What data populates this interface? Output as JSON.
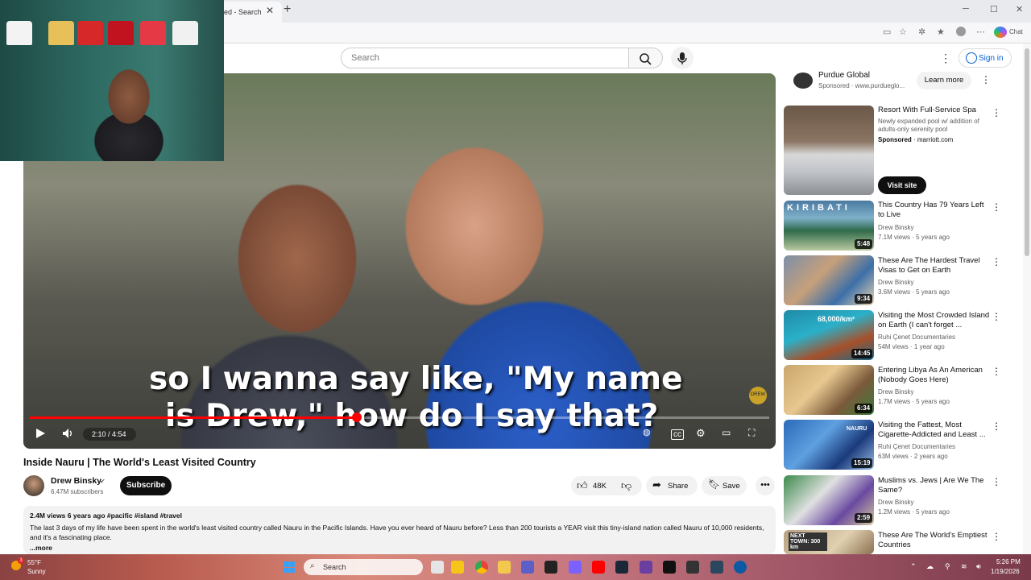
{
  "browser": {
    "tab_title": "ed - Search",
    "tab_close": "✕",
    "new_tab": "+",
    "minimize": "─",
    "maximize": "☐",
    "close": "✕",
    "copilot_label": "Chat"
  },
  "header": {
    "search_placeholder": "Search",
    "menu": "⋮",
    "sign_in": "Sign in"
  },
  "video": {
    "caption_line1": "so I wanna say like, \"My name",
    "caption_line2": "is Drew,\" how do I say that?",
    "time": "2:10 / 4:54",
    "progress_fraction": 0.442,
    "watermark": "DREW"
  },
  "watch": {
    "title": "Inside Nauru | The World's Least Visited Country",
    "channel": "Drew Binsky",
    "subscribers": "6.47M subscribers",
    "subscribe": "Subscribe",
    "likes": "48K",
    "share": "Share",
    "save": "Save",
    "more": "•••",
    "description_stats": "2.4M views  6 years ago  #pacific #island #travel",
    "description": "The last 3 days of my life have been spent in the world's least visited country called Nauru in the Pacific Islands.   Have you ever heard of Nauru before? Less than 200 tourists a YEAR visit this tiny-island nation called Nauru of 10,000 residents, and it's a fascinating place.",
    "description_more": "...more"
  },
  "sidebar": {
    "top_ad": {
      "name": "Purdue Global",
      "sponsored": "Sponsored · www.purdueglo...",
      "cta": "Learn more"
    },
    "ad": {
      "title": "Resort With Full-Service Spa",
      "desc": "Newly expanded pool w/ addition of adults-only serenity pool",
      "sponsored": "Sponsored",
      "domain": " · marriott.com",
      "cta": "Visit site"
    },
    "recs": [
      {
        "title": "This Country Has 79 Years Left to Live",
        "channel": "Drew Binsky",
        "meta": "7.1M views · 5 years ago",
        "duration": "5:48",
        "thumb_text": "KIRIBATI"
      },
      {
        "title": "These Are The Hardest Travel Visas to Get on Earth",
        "channel": "Drew Binsky",
        "meta": "3.6M views · 5 years ago",
        "duration": "9:34",
        "thumb_text": ""
      },
      {
        "title": "Visiting the Most Crowded Island on Earth (I can't forget ...",
        "channel": "Ruhi Çenet Documentaries",
        "meta": "54M views · 1 year ago",
        "duration": "14:45",
        "thumb_text": "68,000/km²"
      },
      {
        "title": "Entering Libya As An American (Nobody Goes Here)",
        "channel": "Drew Binsky",
        "meta": "1.7M views · 5 years ago",
        "duration": "6:34",
        "thumb_text": ""
      },
      {
        "title": "Visiting the Fattest, Most Cigarette-Addicted and Least ...",
        "channel": "Ruhi Çenet Documentaries",
        "meta": "63M views · 2 years ago",
        "duration": "15:19",
        "thumb_text": "NAURU"
      },
      {
        "title": "Muslims vs. Jews | Are We The Same?",
        "channel": "Drew Binsky",
        "meta": "1.2M views · 5 years ago",
        "duration": "2:59",
        "thumb_text": ""
      },
      {
        "title": "These Are The World's Emptiest Countries",
        "channel": "",
        "meta": "",
        "duration": "",
        "thumb_text": "NEXT TOWN: 300 km"
      }
    ]
  },
  "taskbar": {
    "temp": "55°F",
    "condition": "Sunny",
    "weather_badge": "3",
    "search": "Search",
    "time": "5:26 PM",
    "date": "1/19/2026"
  },
  "icons": {
    "search": "search-icon",
    "mic": "microphone-icon",
    "play": "play-icon",
    "volume": "volume-icon",
    "like": "thumbs-up-icon",
    "dislike": "thumbs-down-icon",
    "share": "share-icon",
    "save": "save-icon"
  },
  "colors": {
    "progress": "#ff0000",
    "subscribe_bg": "#0f0f0f",
    "link_blue": "#065fd4"
  }
}
